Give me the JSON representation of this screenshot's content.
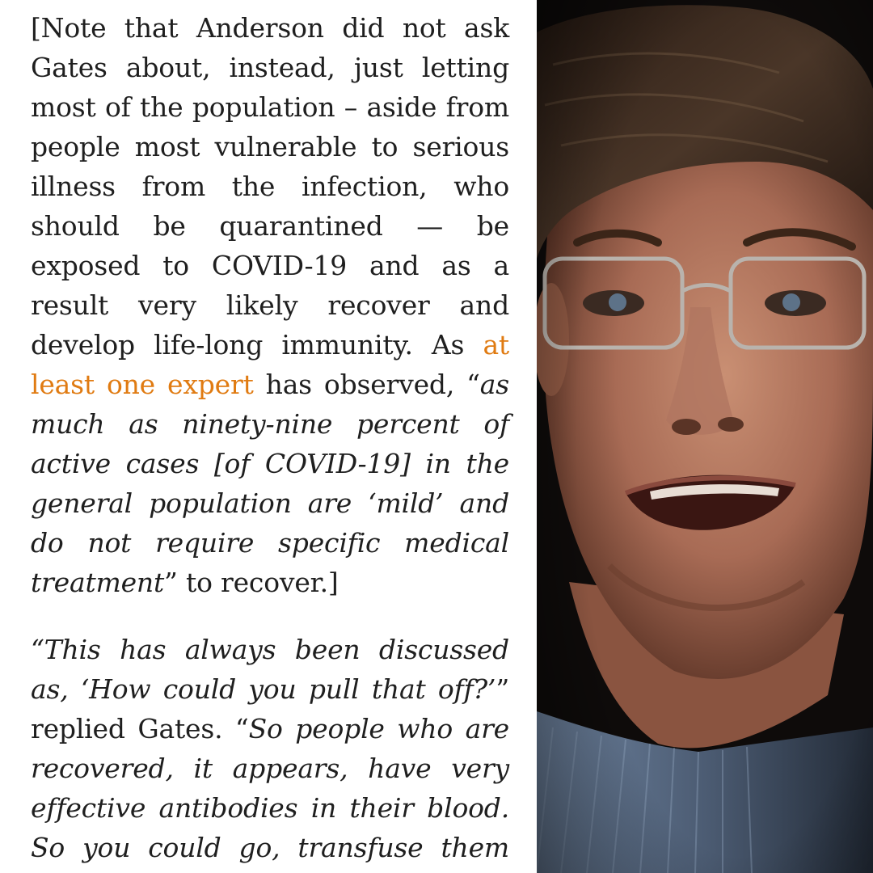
{
  "article": {
    "para1": {
      "before_link": "[Note that Anderson did not ask Gates about, instead, just letting most of the population – aside from people most vulnerable to serious illness from the infection, who should be quarantined — be exposed to COVID-19 and as a result very likely recover and develop life-long immunity. As ",
      "link_text": "at least one expert",
      "after_link": " has observed, “",
      "quote": "as much as ninety-nine percent of active cases [of COVID-19] in the general population are ‘mild’ and do not require specific medical treatment",
      "tail": "” to recover.]"
    },
    "para2": {
      "quote1": "“This has always been discussed as, ‘How could you pull that off?’",
      "mid": "” replied Gates. “",
      "quote2": "So people who are recovered, it appears, have very effective antibodies in their blood. So you could go, transfuse them and"
    }
  },
  "colors": {
    "link": "#e07b12",
    "text": "#1f1f1f",
    "photo_background": "#0e0b0a"
  }
}
